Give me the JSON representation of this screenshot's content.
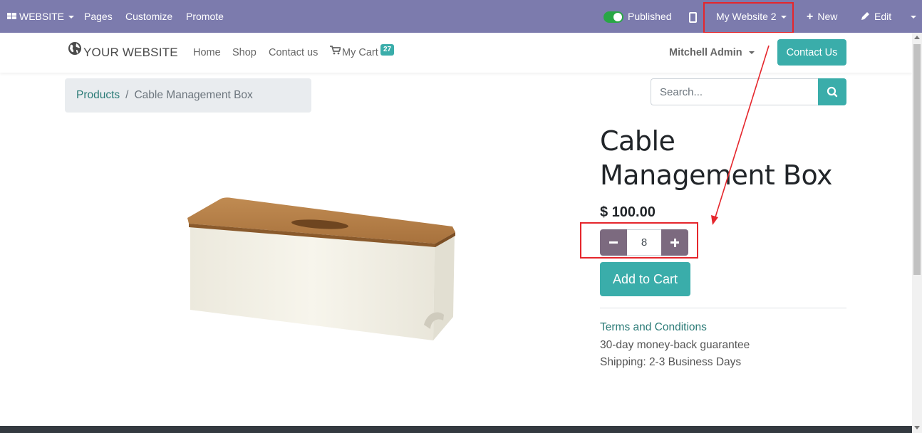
{
  "adminbar": {
    "app_label": "WEBSITE",
    "menu": [
      "Pages",
      "Customize",
      "Promote"
    ],
    "published_label": "Published",
    "website_selector": "My Website 2",
    "new_label": "New",
    "edit_label": "Edit"
  },
  "header": {
    "logo": "YOUR WEBSITE",
    "nav": [
      "Home",
      "Shop",
      "Contact us"
    ],
    "cart_label": "My Cart",
    "cart_count": "27",
    "user": "Mitchell Admin",
    "contact_button": "Contact Us"
  },
  "breadcrumb": {
    "parent": "Products",
    "separator": "/",
    "current": "Cable Management Box"
  },
  "search": {
    "placeholder": "Search..."
  },
  "product": {
    "name": "Cable Management Box",
    "price": "$ 100.00",
    "quantity": "8",
    "add_to_cart": "Add to Cart",
    "terms": "Terms and Conditions",
    "guarantee": "30-day money-back guarantee",
    "shipping": "Shipping: 2-3 Business Days"
  },
  "colors": {
    "adminbar": "#7c7bad",
    "accent": "#3aadaa",
    "quantity_buttons": "#7c6a7f",
    "annotation": "#e5262c"
  }
}
